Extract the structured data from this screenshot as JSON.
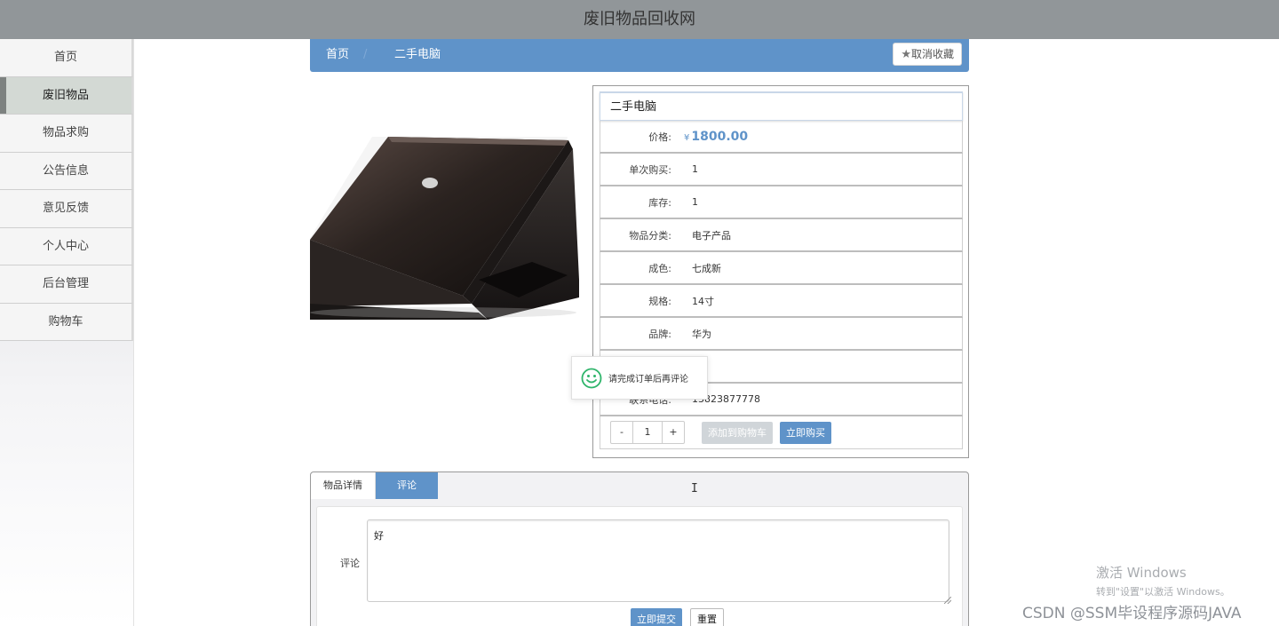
{
  "site": {
    "title": "废旧物品回收网"
  },
  "sidebar": {
    "items": [
      {
        "label": "首页"
      },
      {
        "label": "废旧物品"
      },
      {
        "label": "物品求购"
      },
      {
        "label": "公告信息"
      },
      {
        "label": "意见反馈"
      },
      {
        "label": "个人中心"
      },
      {
        "label": "后台管理"
      },
      {
        "label": "购物车"
      }
    ],
    "active_index": 1
  },
  "breadcrumb": {
    "home": "首页",
    "separator": "/",
    "current": "二手电脑"
  },
  "favorite_button": {
    "label": "取消收藏",
    "icon": "star-icon"
  },
  "product": {
    "name": "二手电脑",
    "price_label": "价格:",
    "currency": "¥",
    "price": "1800.00",
    "fields": [
      {
        "label": "单次购买:",
        "value": "1"
      },
      {
        "label": "库存:",
        "value": "1"
      },
      {
        "label": "物品分类:",
        "value": "电子产品"
      },
      {
        "label": "成色:",
        "value": "七成新"
      },
      {
        "label": "规格:",
        "value": "14寸"
      },
      {
        "label": "品牌:",
        "value": "华为"
      },
      {
        "label": "",
        "value": ""
      },
      {
        "label": "联系电话:",
        "value": "13823877778"
      }
    ],
    "quantity": {
      "minus": "-",
      "value": "1",
      "plus": "+"
    },
    "add_to_cart_label": "添加到购物车",
    "buy_now_label": "立即购买"
  },
  "toast": {
    "message": "请完成订单后再评论",
    "icon": "smile-icon"
  },
  "tabs": [
    {
      "label": "物品详情"
    },
    {
      "label": "评论"
    }
  ],
  "active_tab": 1,
  "comment_form": {
    "label": "评论",
    "value": "好",
    "submit_label": "立即提交",
    "reset_label": "重置"
  },
  "watermarks": {
    "windows_line1": "激活 Windows",
    "windows_line2": "转到\"设置\"以激活 Windows。",
    "csdn": "CSDN @SSM毕设程序源码JAVA"
  },
  "colors": {
    "accent": "#5f93c9",
    "topbar": "#919699",
    "disabled_button": "#d0d5d9",
    "toast_icon": "#2fb56b"
  }
}
